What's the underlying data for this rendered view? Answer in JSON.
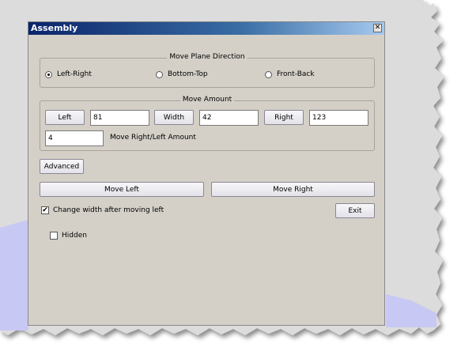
{
  "window": {
    "title": "Assembly",
    "close_glyph": "✕"
  },
  "move_plane": {
    "legend": "Move Plane Direction",
    "options": [
      {
        "label": "Left-Right",
        "checked": true
      },
      {
        "label": "Bottom-Top",
        "checked": false
      },
      {
        "label": "Front-Back",
        "checked": false
      }
    ]
  },
  "move_amount": {
    "legend": "Move Amount",
    "left_button": "Left",
    "left_value": "81",
    "width_button": "Width",
    "width_value": "42",
    "right_button": "Right",
    "right_value": "123",
    "amount_value": "4",
    "amount_label": "Move Right/Left Amount"
  },
  "advanced_button": "Advanced",
  "move_left_button": "Move Left",
  "move_right_button": "Move Right",
  "change_width": {
    "label": "Change width after moving left",
    "checked": true
  },
  "exit_button": "Exit",
  "hidden": {
    "label": "Hidden",
    "checked": false
  },
  "colors": {
    "dialog_bg": "#d4d0c8",
    "title_bar": "#0a246a",
    "backdrop": "#c8c8f4"
  }
}
